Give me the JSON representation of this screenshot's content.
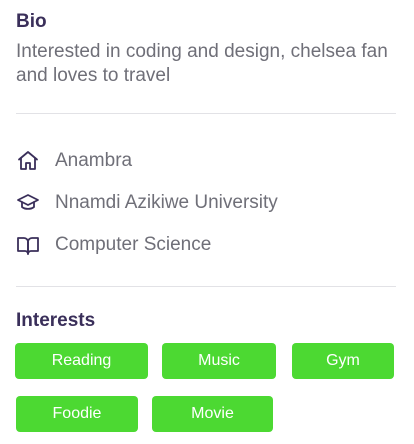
{
  "bio": {
    "title": "Bio",
    "text": "Interested in coding and design, chelsea fan and loves to travel"
  },
  "details": [
    {
      "icon": "home-icon",
      "label": "Anambra"
    },
    {
      "icon": "graduation-cap-icon",
      "label": "Nnamdi Azikiwe University"
    },
    {
      "icon": "book-open-icon",
      "label": "Computer Science"
    }
  ],
  "interests": {
    "title": "Interests",
    "tags": [
      "Reading",
      "Music",
      "Gym",
      "Foodie",
      "Movie"
    ]
  },
  "colors": {
    "heading": "#3a2f5a",
    "body_text": "#6f6f78",
    "tag_background": "#4cd932",
    "tag_text": "#ffffff",
    "divider": "#e2e2e6"
  }
}
